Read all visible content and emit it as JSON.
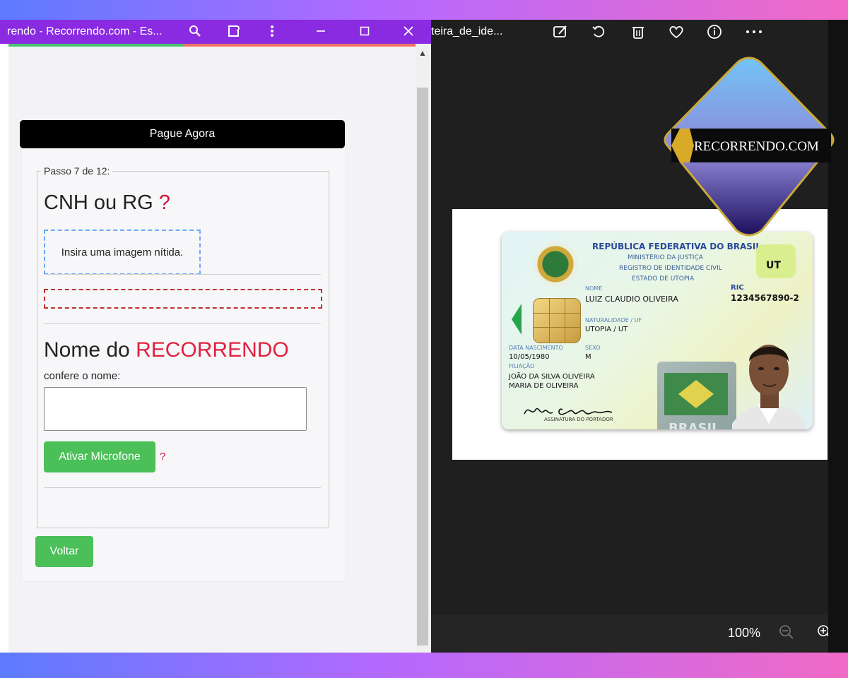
{
  "browser": {
    "title": "rendo - Recorrendo.com - Es...",
    "progress_fraction": 0.43,
    "icons": [
      "search-icon",
      "extensions-icon",
      "more-icon",
      "minimize-icon",
      "maximize-icon",
      "close-icon"
    ]
  },
  "form": {
    "pay_button": "Pague Agora",
    "step": "Passo 7 de 12:",
    "heading_doc": "CNH ou RG",
    "help_mark": "?",
    "upload_hint": "Insira uma imagem nítida.",
    "heading_name_prefix": "Nome do",
    "heading_name_brand": "RECORRENDO",
    "name_label": "confere o nome:",
    "name_value": "",
    "mic_button": "Ativar Microfone",
    "mic_help": "?",
    "back_button": "Voltar"
  },
  "viewer": {
    "title": "teira_de_ide...",
    "zoom": "100%",
    "icons": [
      "edit-image-icon",
      "rotate-icon",
      "trash-icon",
      "heart-icon",
      "info-icon",
      "more-icon"
    ]
  },
  "id_card": {
    "country": "REPÚBLICA FEDERATIVA DO BRASIL",
    "ministry": "MINISTÉRIO DA JUSTIÇA",
    "registry": "REGISTRO DE IDENTIDADE CIVIL",
    "state": "ESTADO DE UTOPIA",
    "state_badge": "UT",
    "name_label": "NOME",
    "name": "LUIZ CLAUDIO OLIVEIRA",
    "ric_label": "RIC",
    "ric": "1234567890-2",
    "nat_label": "NATURALIDADE / UF",
    "naturality": "UTOPIA / UT",
    "birth_label": "DATA NASCIMENTO",
    "birth": "10/05/1980",
    "sex_label": "SEXO",
    "sex": "M",
    "filiation_label": "FILIAÇÃO",
    "father": "JOÃO DA SILVA OLIVEIRA",
    "mother": "MARIA DE OLIVEIRA",
    "signature_label": "ASSINATURA DO PORTADOR",
    "holo_text": "BRASIL"
  },
  "watermark": {
    "text": "RECORRENDO.COM"
  },
  "colors": {
    "titlebar": "#8a2be2",
    "accent_green": "#4bbf58",
    "help_red": "#d0103a",
    "brand_red": "#e0213f"
  }
}
